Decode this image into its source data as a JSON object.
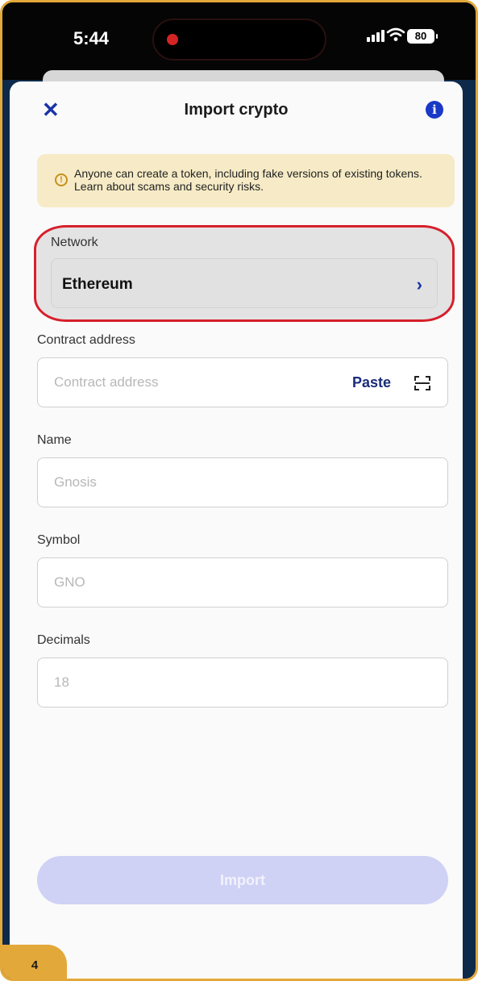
{
  "status_bar": {
    "time": "5:44",
    "battery": "80"
  },
  "header": {
    "title": "Import crypto"
  },
  "warning": {
    "text": "Anyone can create a token, including fake versions of existing tokens. Learn about scams and security risks."
  },
  "network": {
    "label": "Network",
    "value": "Ethereum"
  },
  "contract": {
    "label": "Contract address",
    "placeholder": "Contract address",
    "paste_label": "Paste"
  },
  "name": {
    "label": "Name",
    "placeholder": "Gnosis"
  },
  "symbol": {
    "label": "Symbol",
    "placeholder": "GNO"
  },
  "decimals": {
    "label": "Decimals",
    "placeholder": "18"
  },
  "import_button": {
    "label": "Import"
  },
  "step_badge": "4",
  "colors": {
    "accent": "#1a33a8",
    "highlight": "#d71f2b",
    "frame": "#e3a83a"
  }
}
